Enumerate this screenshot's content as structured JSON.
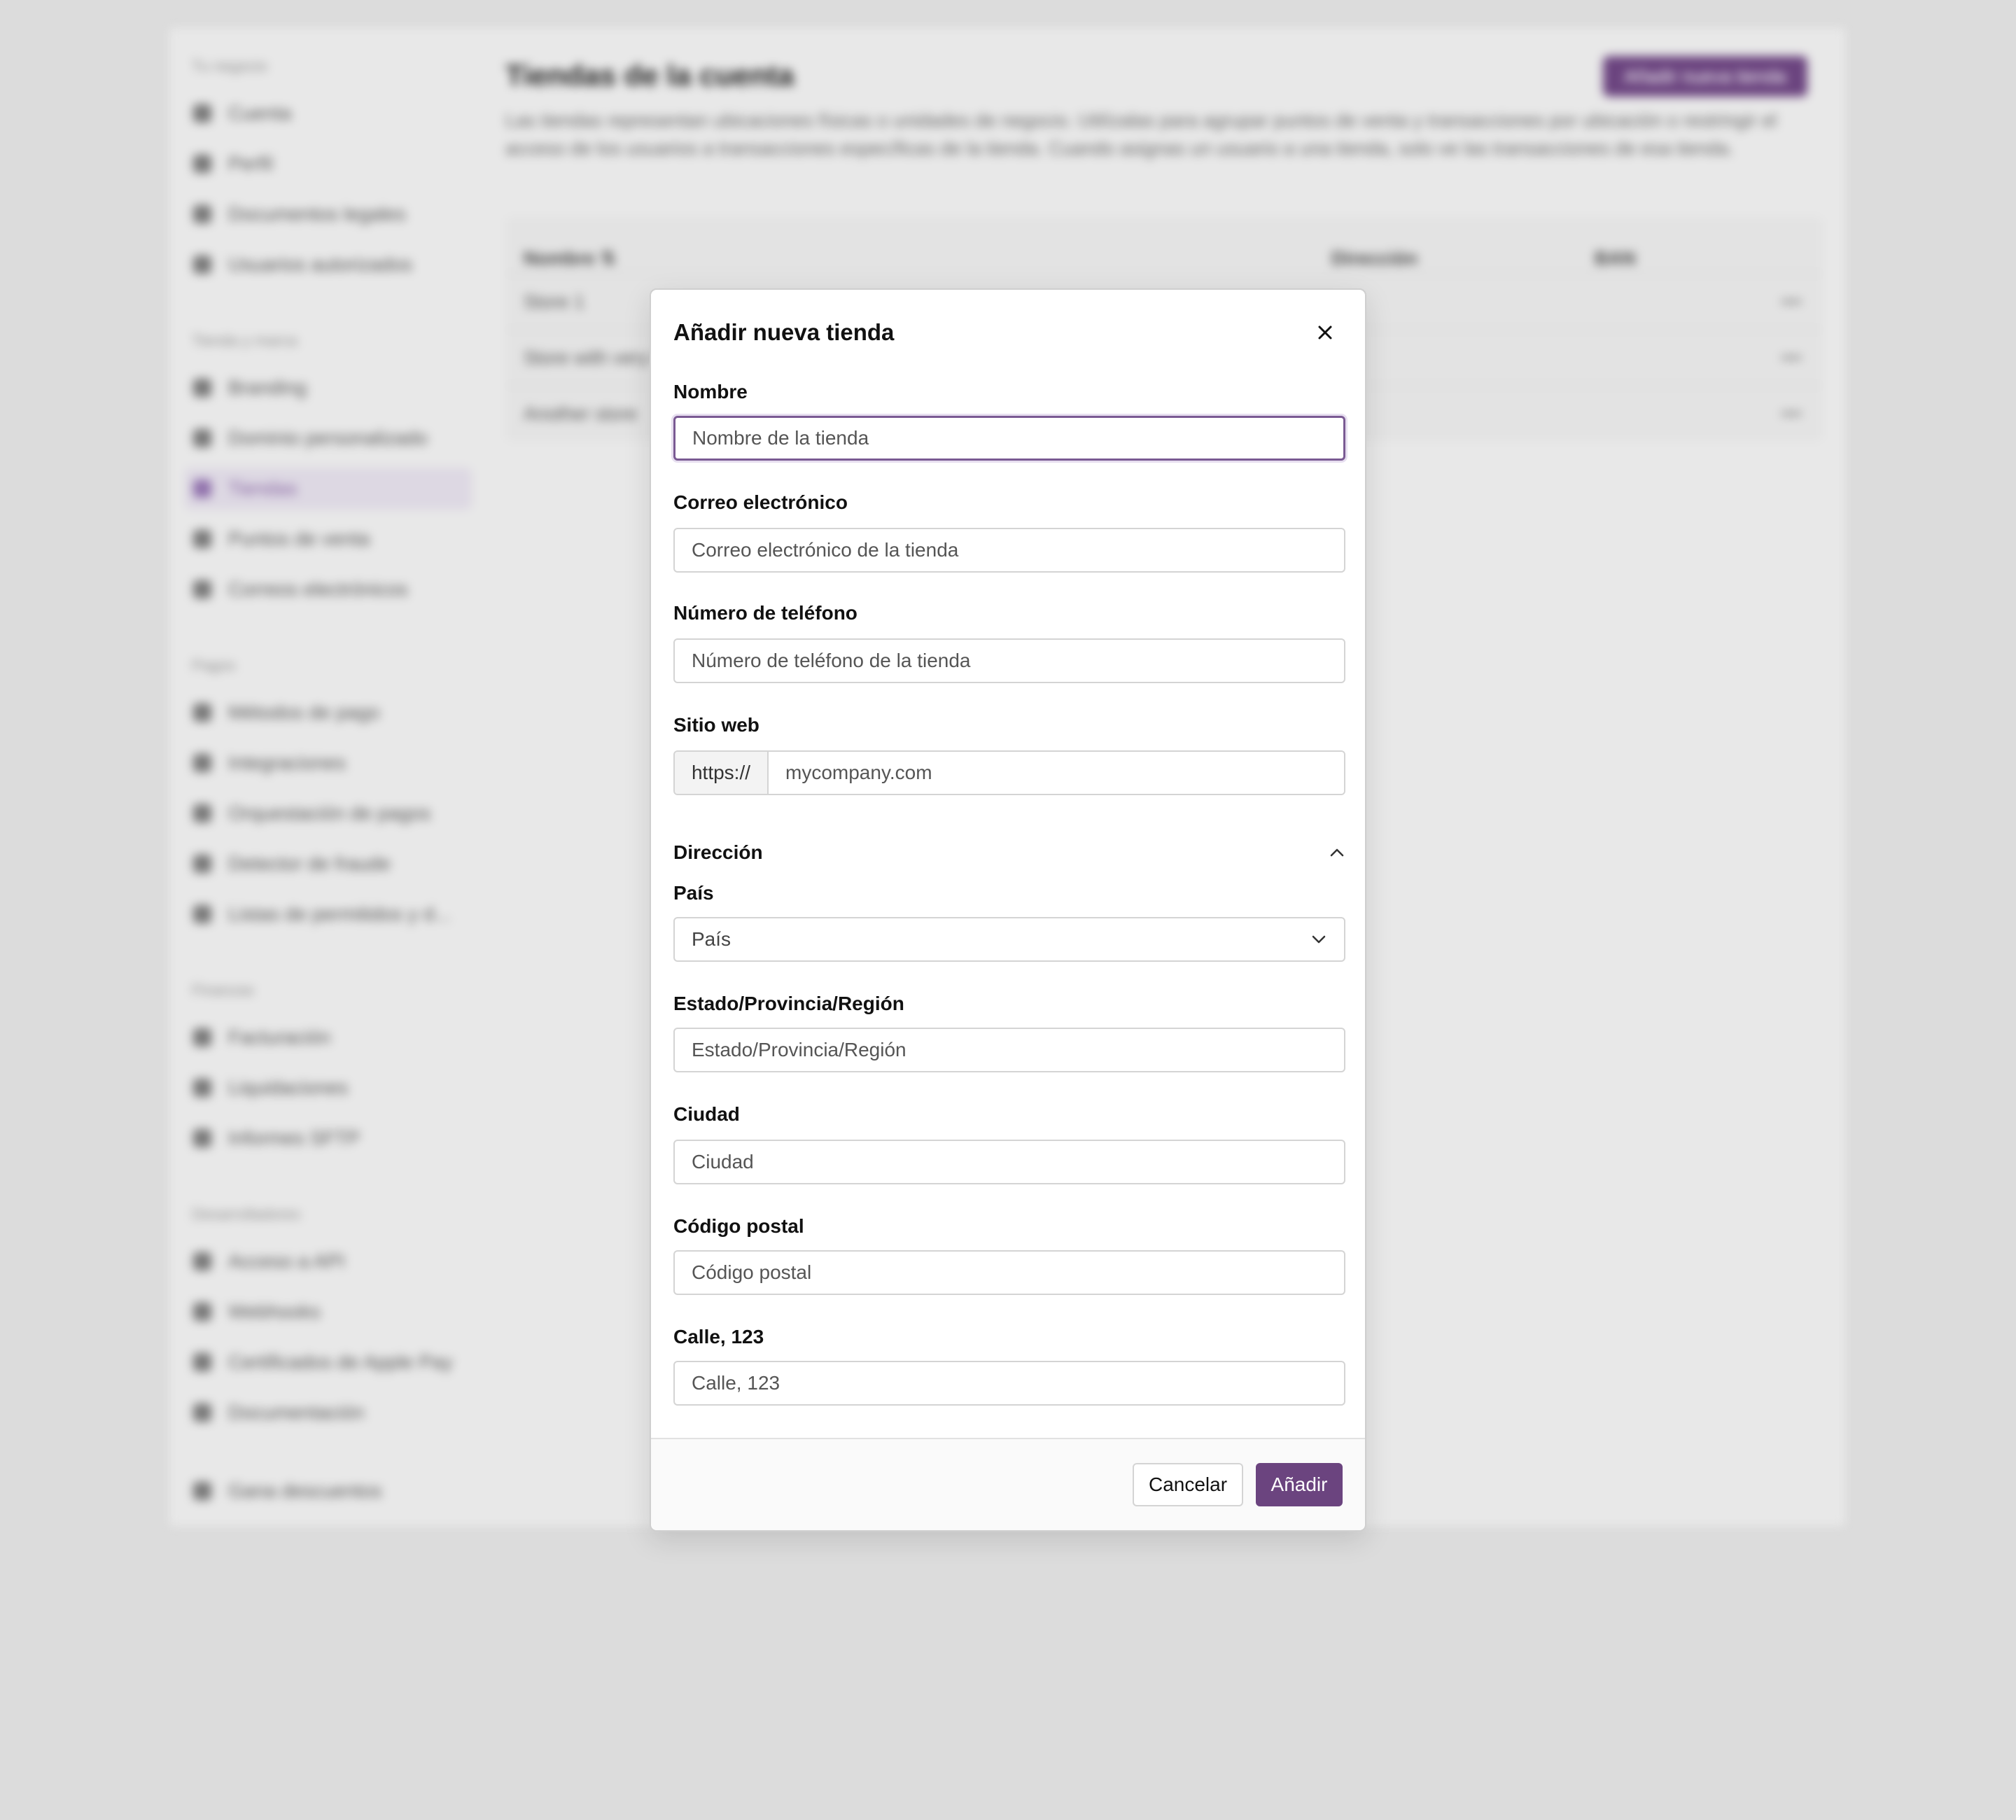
{
  "background": {
    "sidebar": {
      "sections": [
        {
          "title": "Tu negocio",
          "items": [
            "Cuenta",
            "Perfil",
            "Documentos legales",
            "Usuarios autorizados"
          ]
        },
        {
          "title": "Tienda y marca",
          "items": [
            "Branding",
            "Dominio personalizado",
            "Tiendas",
            "Puntos de venta",
            "Correos electrónicos"
          ]
        },
        {
          "title": "Pagos",
          "items": [
            "Métodos de pago",
            "Integraciones",
            "Orquestación de pagos",
            "Detector de fraude",
            "Listas de permitidos y d..."
          ]
        },
        {
          "title": "Finanzas",
          "items": [
            "Facturación",
            "Liquidaciones",
            "Informes SFTP"
          ]
        },
        {
          "title": "Desarrolladores",
          "items": [
            "Acceso a API",
            "Webhooks",
            "Certificados de Apple Pay",
            "Documentación"
          ]
        }
      ],
      "bottom_item": "Gana descuentos",
      "active_item": "Tiendas"
    },
    "main": {
      "title": "Tiendas de la cuenta",
      "description": "Las tiendas representan ubicaciones físicas o unidades de negocio. Utilízalas para agrupar puntos de venta y transacciones por ubicación o restringir el acceso de los usuarios a transacciones específicas de la tienda. Cuando asignas un usuario a una tienda, solo ve las transacciones de esa tienda.",
      "new_button": "Añadir nueva tienda",
      "table": {
        "columns": [
          "Nombre ⇅",
          "Dirección",
          "BAN"
        ],
        "rows": [
          "Store 1",
          "Store with very long name",
          "Another store"
        ]
      }
    }
  },
  "modal": {
    "title": "Añadir nueva tienda",
    "fields": {
      "name": {
        "label": "Nombre",
        "placeholder": "Nombre de la tienda",
        "value": ""
      },
      "email": {
        "label": "Correo electrónico",
        "placeholder": "Correo electrónico de la tienda",
        "value": ""
      },
      "phone": {
        "label": "Número de teléfono",
        "placeholder": "Número de teléfono de la tienda",
        "value": ""
      },
      "website": {
        "label": "Sitio web",
        "prefix": "https://",
        "placeholder": "mycompany.com",
        "value": ""
      }
    },
    "address": {
      "section_title": "Dirección",
      "expanded": true,
      "country": {
        "label": "País",
        "selected": "País"
      },
      "state": {
        "label": "Estado/Provincia/Región",
        "placeholder": "Estado/Provincia/Región"
      },
      "city": {
        "label": "Ciudad",
        "placeholder": "Ciudad"
      },
      "postal": {
        "label": "Código postal",
        "placeholder": "Código postal"
      },
      "street": {
        "label": "Calle, 123",
        "placeholder": "Calle, 123"
      }
    },
    "footer": {
      "cancel_label": "Cancelar",
      "add_label": "Añadir"
    }
  },
  "colors": {
    "accent": "#6b447f",
    "focus_ring": "#7a5a93",
    "overlay": "#dcdcdc"
  }
}
